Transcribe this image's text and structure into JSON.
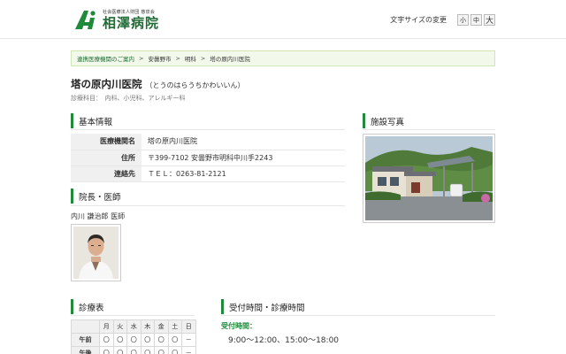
{
  "header": {
    "logo_sub": "社会医療法人財団 慈泉会",
    "logo_main": "相澤病院",
    "font_size_label": "文字サイズの変更",
    "font_sizes": [
      "小",
      "中",
      "大"
    ]
  },
  "breadcrumb": {
    "items": [
      "連携医療機関のご案内",
      "安曇野市",
      "明科",
      "塔の原内川医院"
    ],
    "separator": ">"
  },
  "page": {
    "title": "塔の原内川医院",
    "title_kana": "（とうのはらうちかわいいん）",
    "departments": "診療科目：　内科、小児科、アレルギー科"
  },
  "sections": {
    "basic_info": "基本情報",
    "facility_photo": "施設写真",
    "director": "院長・医師",
    "schedule": "診療表",
    "reception": "受付時間・診療時間"
  },
  "basic_info": {
    "rows": [
      {
        "label": "医療機関名",
        "value": "塔の原内川医院"
      },
      {
        "label": "住所",
        "value": "〒399-7102 安曇野市明科中川手2243"
      },
      {
        "label": "連絡先",
        "value": "ＴＥＬ：0263-81-2121"
      }
    ]
  },
  "doctor": {
    "name": "内川 謙治郎 医師"
  },
  "schedule": {
    "days": [
      "月",
      "火",
      "水",
      "木",
      "金",
      "土",
      "日"
    ],
    "rows": [
      {
        "label": "午前",
        "cells": [
          "〇",
          "〇",
          "〇",
          "〇",
          "〇",
          "〇",
          "－"
        ]
      },
      {
        "label": "午後",
        "cells": [
          "〇",
          "〇",
          "〇",
          "〇",
          "〇",
          "〇",
          "－"
        ]
      }
    ]
  },
  "reception": {
    "label": "受付時間：",
    "hours": "9:00～12:00、15:00～18:00"
  },
  "colors": {
    "brand_green": "#1e6b34",
    "accent_green": "#1e8a3a",
    "breadcrumb_bg": "#f2f9ea"
  }
}
